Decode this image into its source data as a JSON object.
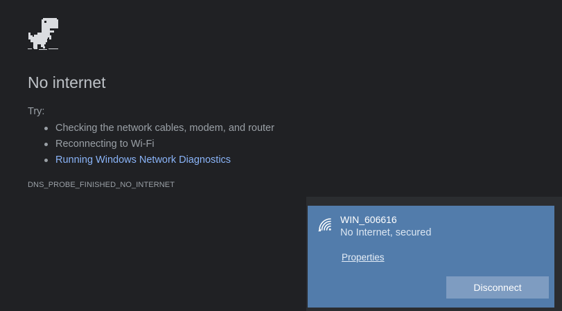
{
  "error_page": {
    "icon": "dino-icon",
    "title": "No internet",
    "try_label": "Try:",
    "suggestions": [
      "Checking the network cables, modem, and router",
      "Reconnecting to Wi-Fi",
      "Running Windows Network Diagnostics"
    ],
    "error_code": "DNS_PROBE_FINISHED_NO_INTERNET"
  },
  "network_flyout": {
    "icon": "wifi-icon",
    "network_name": "WIN_606616",
    "network_status": "No Internet, secured",
    "properties_label": "Properties",
    "disconnect_label": "Disconnect"
  },
  "colors": {
    "page_background": "#202124",
    "title_text": "#bdc1c6",
    "body_text": "#9aa0a6",
    "link_text": "#8ab4f8",
    "flyout_background": "#527cab",
    "button_background": "#7e9cc1"
  }
}
